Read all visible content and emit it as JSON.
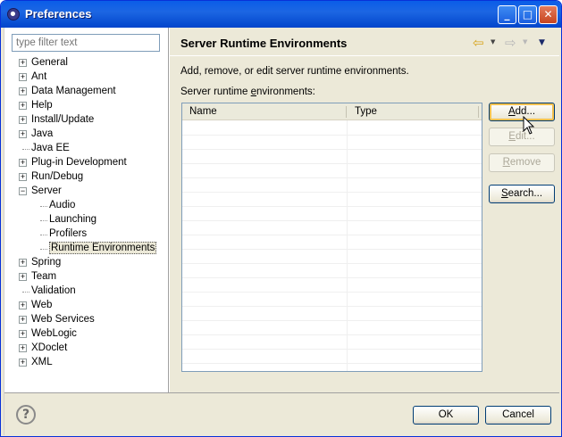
{
  "window": {
    "title": "Preferences",
    "minimize": "_",
    "maximize": "□",
    "close": "✕"
  },
  "filter": {
    "placeholder": "type filter text"
  },
  "tree": {
    "items": [
      {
        "label": "General",
        "expander": "+"
      },
      {
        "label": "Ant",
        "expander": "+"
      },
      {
        "label": "Data Management",
        "expander": "+"
      },
      {
        "label": "Help",
        "expander": "+"
      },
      {
        "label": "Install/Update",
        "expander": "+"
      },
      {
        "label": "Java",
        "expander": "+"
      },
      {
        "label": "Java EE",
        "expander": ""
      },
      {
        "label": "Plug-in Development",
        "expander": "+"
      },
      {
        "label": "Run/Debug",
        "expander": "+"
      },
      {
        "label": "Server",
        "expander": "−"
      },
      {
        "label": "Audio",
        "expander": ""
      },
      {
        "label": "Launching",
        "expander": ""
      },
      {
        "label": "Profilers",
        "expander": ""
      },
      {
        "label": "Runtime Environments",
        "expander": "",
        "selected": true
      },
      {
        "label": "Spring",
        "expander": "+"
      },
      {
        "label": "Team",
        "expander": "+"
      },
      {
        "label": "Validation",
        "expander": ""
      },
      {
        "label": "Web",
        "expander": "+"
      },
      {
        "label": "Web Services",
        "expander": "+"
      },
      {
        "label": "WebLogic",
        "expander": "+"
      },
      {
        "label": "XDoclet",
        "expander": "+"
      },
      {
        "label": "XML",
        "expander": "+"
      }
    ]
  },
  "page": {
    "title": "Server Runtime Environments",
    "description": "Add, remove, or edit server runtime environments.",
    "list_label_pre": "Server runtime ",
    "list_label_u": "e",
    "list_label_post": "nvironments:",
    "nav_back": "⇦",
    "nav_forward": "⇨",
    "dropdown": "▼"
  },
  "table": {
    "columns": [
      "Name",
      "Type"
    ],
    "rows": []
  },
  "buttons": {
    "add_u": "A",
    "add_rest": "dd...",
    "edit_u": "E",
    "edit_rest": "dit...",
    "remove_u": "R",
    "remove_rest": "emove",
    "search_u": "S",
    "search_rest": "earch...",
    "ok": "OK",
    "cancel": "Cancel",
    "help": "?"
  }
}
